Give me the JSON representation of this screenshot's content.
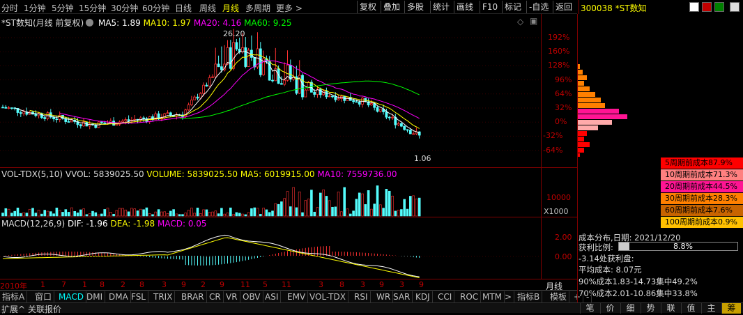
{
  "toolbar": {
    "periods": [
      "分时",
      "1分钟",
      "5分钟",
      "15分钟",
      "30分钟",
      "60分钟",
      "日线",
      "周线",
      "月线",
      "多周期",
      "更多"
    ],
    "active_period": "月线",
    "buttons": [
      "复权",
      "叠加",
      "多股",
      "统计",
      "画线",
      "F10",
      "标记",
      "-自选",
      "返回"
    ]
  },
  "stock": {
    "code_name": "300038 *ST数知"
  },
  "main_chart": {
    "title": "*ST数知(月线 前复权)",
    "ma5": "MA5: 1.89",
    "ma10": "MA10: 1.97",
    "ma20": "MA20: 4.16",
    "ma60": "MA60: 9.25",
    "high_label": "26.20",
    "low_label": "1.06",
    "pct_ticks": [
      "192%",
      "160%",
      "128%",
      "96%",
      "64%",
      "32%",
      "0%",
      "-32%",
      "-64%"
    ]
  },
  "vol_chart": {
    "title": "VOL-TDX(5,10)",
    "vvol": "VVOL: 5839025.50",
    "volume": "VOLUME: 5839025.50",
    "ma5": "MA5: 6019915.00",
    "ma10": "MA10: 7559736.00",
    "tick": "10000",
    "unit": "X1000"
  },
  "macd_chart": {
    "title": "MACD(12,26,9)",
    "dif": "DIF: -1.96",
    "dea": "DEA: -1.98",
    "macd": "MACD: 0.05",
    "ticks": [
      "2.00",
      "0.00"
    ]
  },
  "time_axis": {
    "labels": [
      "2010年",
      "1",
      "7",
      "1",
      "8",
      "2",
      "8",
      "3",
      "9",
      "2",
      "9",
      "11",
      "5",
      "11",
      "3",
      "8",
      "3",
      "9",
      "3",
      "9"
    ],
    "period": "月线"
  },
  "cost_dist": {
    "rows": [
      {
        "label": "5周期前成本87.9%",
        "color": "#ff0000"
      },
      {
        "label": "10周期前成本71.3%",
        "color": "#ff8080"
      },
      {
        "label": "20周期前成本44.5%",
        "color": "#ff1493"
      },
      {
        "label": "30周期前成本28.3%",
        "color": "#ff8000"
      },
      {
        "label": "60周期前成本7.6%",
        "color": "#c86400"
      },
      {
        "label": "100周期前成本0.9%",
        "color": "#ffc000"
      }
    ],
    "date_line": "成本分布,日期: 2021/12/20",
    "profit_label": "获利比例:",
    "profit_value": "8.8%",
    "profit_ratio": 0.088,
    "profit_price": "-3.14处获利盘:",
    "avg_cost": "平均成本: 8.07元",
    "c90": "90%成本1.83-14.73集中49.2%",
    "c70": "70%成本2.01-10.86集中33.8%"
  },
  "indicators": [
    "指标A",
    "窗口",
    "MACD",
    "DMI",
    "DMA",
    "FSL",
    "TRIX",
    "BRAR",
    "CR",
    "VR",
    "OBV",
    "ASI",
    "EMV",
    "VOL-TDX",
    "RSI",
    "WR",
    "SAR",
    "KDJ",
    "CCI",
    "ROC",
    "MTM",
    ">",
    "指标B",
    "模板",
    "+",
    "-"
  ],
  "active_indicator": "MACD",
  "bottom": {
    "expand": "扩展^",
    "related": "关联报价",
    "right_buttons": [
      "笔",
      "价",
      "细",
      "势",
      "联",
      "值",
      "主",
      "筹"
    ]
  },
  "colors": {
    "up": "#ff3232",
    "down": "#54fcfc",
    "ma5": "#ffffff",
    "ma10": "#ffff00",
    "ma20": "#ff00ff",
    "ma60": "#00ff00"
  }
}
